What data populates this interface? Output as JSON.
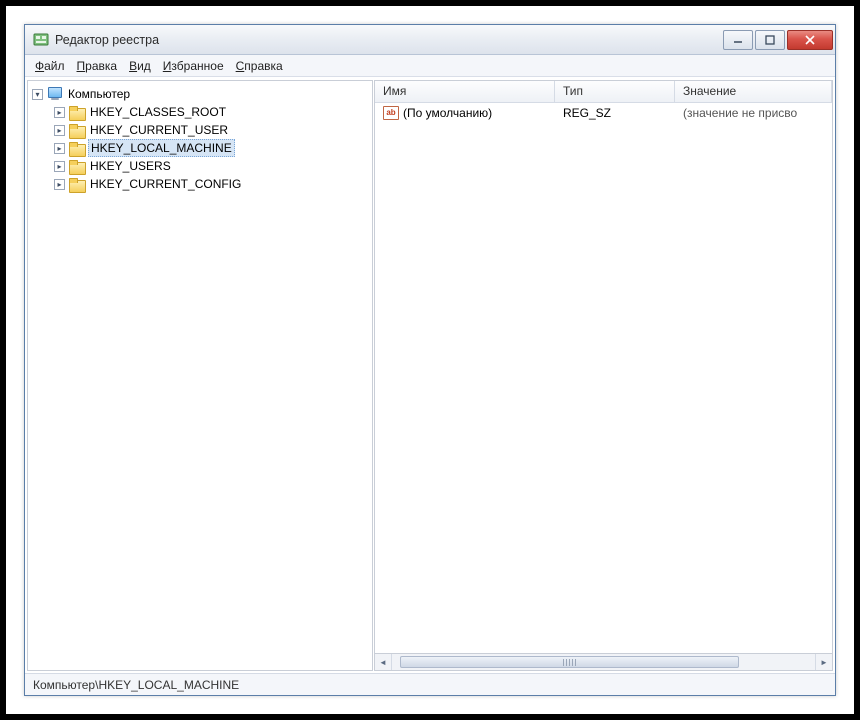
{
  "window": {
    "title": "Редактор реестра"
  },
  "menu": {
    "file": "Файл",
    "edit": "Правка",
    "view": "Вид",
    "favorites": "Избранное",
    "help": "Справка"
  },
  "tree": {
    "root": "Компьютер",
    "hives": [
      "HKEY_CLASSES_ROOT",
      "HKEY_CURRENT_USER",
      "HKEY_LOCAL_MACHINE",
      "HKEY_USERS",
      "HKEY_CURRENT_CONFIG"
    ],
    "selected_index": 2
  },
  "list": {
    "columns": {
      "name": "Имя",
      "type": "Тип",
      "value": "Значение"
    },
    "rows": [
      {
        "name": "(По умолчанию)",
        "type": "REG_SZ",
        "value": "(значение не присво"
      }
    ]
  },
  "status": {
    "path": "Компьютер\\HKEY_LOCAL_MACHINE"
  },
  "icons": {
    "string_label": "ab"
  }
}
